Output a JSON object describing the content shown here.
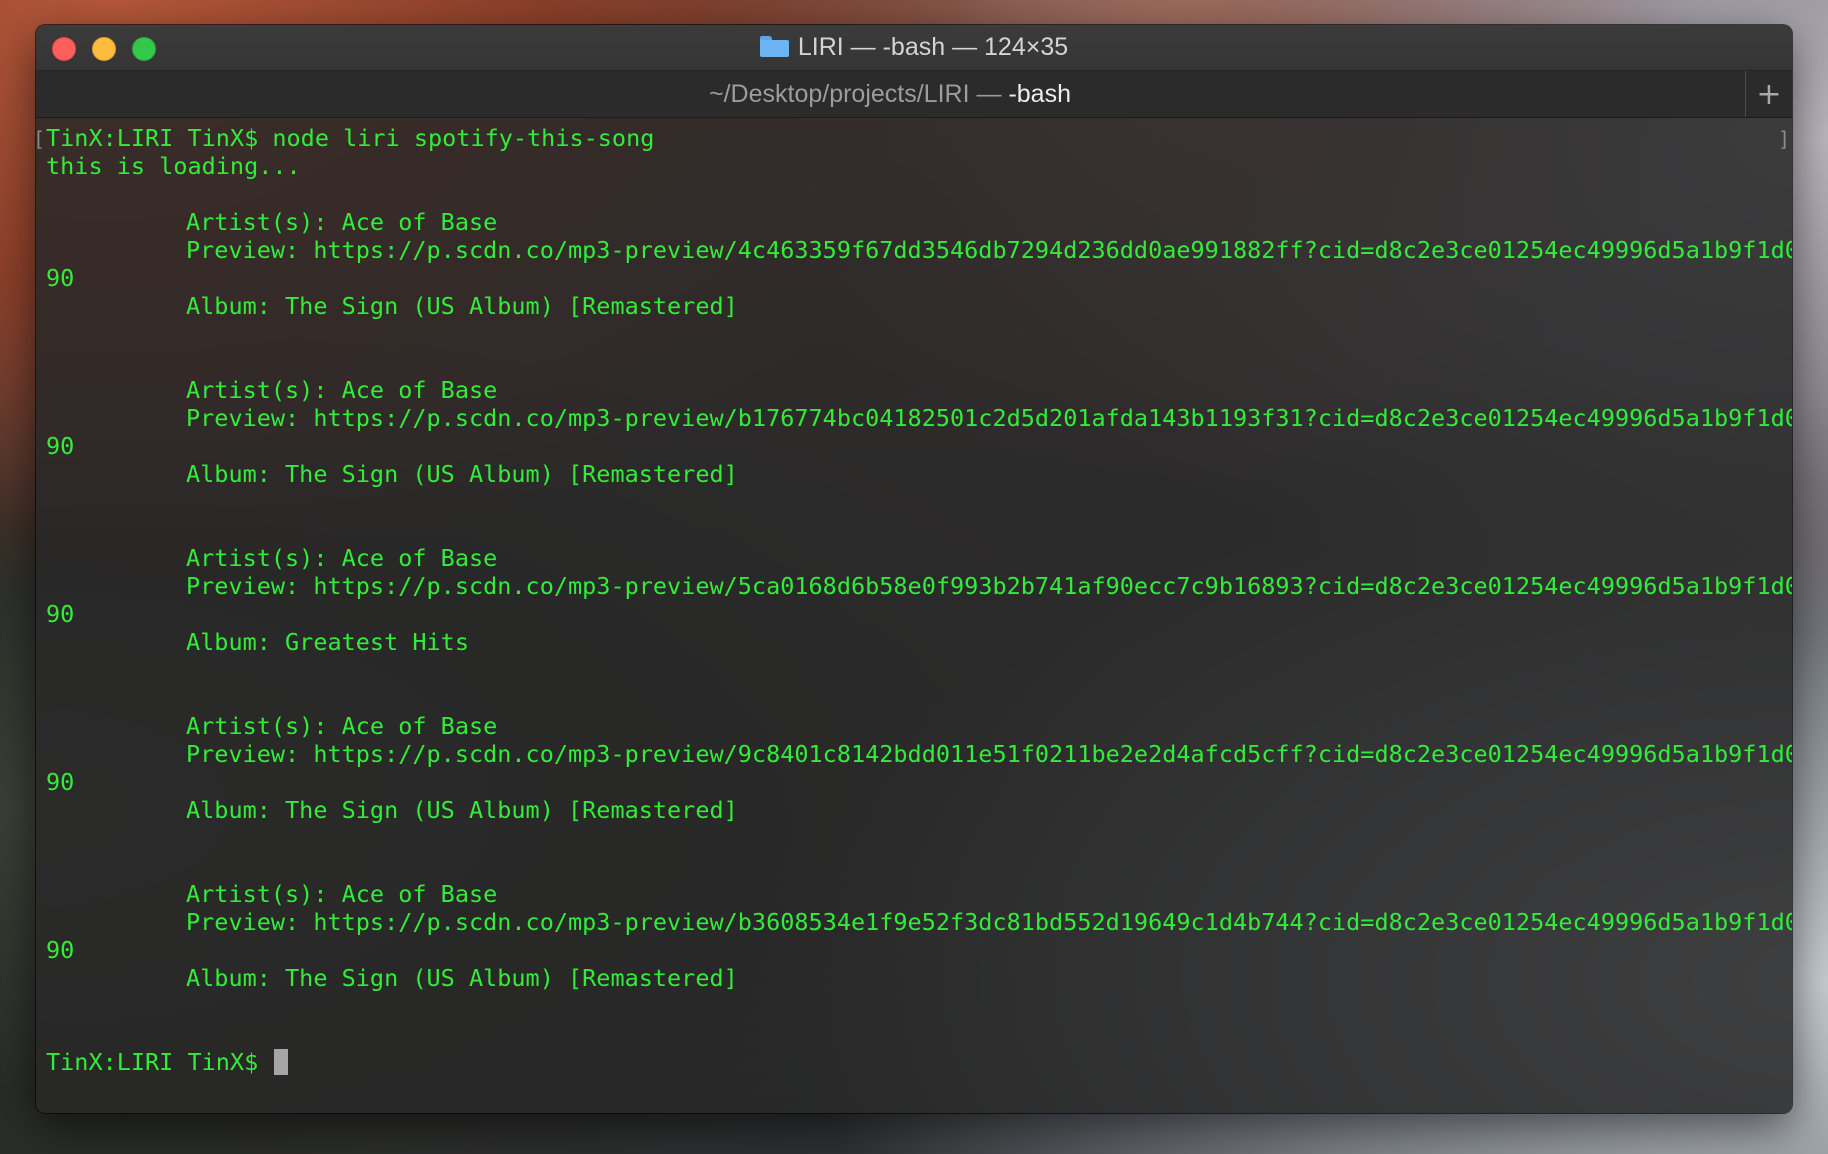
{
  "window": {
    "title": "LIRI — -bash — 124×35",
    "tab_path": "~/Desktop/projects/LIRI — ",
    "tab_command": "-bash",
    "new_tab_label": "+"
  },
  "terminal": {
    "command_line": "TinX:LIRI TinX$ node liri spotify-this-song",
    "loading_message": "this is loading...",
    "tracks": [
      {
        "artist": "Artist(s): Ace of Base",
        "preview": "Preview: https://p.scdn.co/mp3-preview/4c463359f67dd3546db7294d236dd0ae991882ff?cid=d8c2e3ce01254ec49996d5a1b9f1d0",
        "preview_wrap": "90",
        "album": "Album: The Sign (US Album) [Remastered]"
      },
      {
        "artist": "Artist(s): Ace of Base",
        "preview": "Preview: https://p.scdn.co/mp3-preview/b176774bc04182501c2d5d201afda143b1193f31?cid=d8c2e3ce01254ec49996d5a1b9f1d0",
        "preview_wrap": "90",
        "album": "Album: The Sign (US Album) [Remastered]"
      },
      {
        "artist": "Artist(s): Ace of Base",
        "preview": "Preview: https://p.scdn.co/mp3-preview/5ca0168d6b58e0f993b2b741af90ecc7c9b16893?cid=d8c2e3ce01254ec49996d5a1b9f1d0",
        "preview_wrap": "90",
        "album": "Album: Greatest Hits"
      },
      {
        "artist": "Artist(s): Ace of Base",
        "preview": "Preview: https://p.scdn.co/mp3-preview/9c8401c8142bdd011e51f0211be2e2d4afcd5cff?cid=d8c2e3ce01254ec49996d5a1b9f1d0",
        "preview_wrap": "90",
        "album": "Album: The Sign (US Album) [Remastered]"
      },
      {
        "artist": "Artist(s): Ace of Base",
        "preview": "Preview: https://p.scdn.co/mp3-preview/b3608534e1f9e52f3dc81bd552d19649c1d4b744?cid=d8c2e3ce01254ec49996d5a1b9f1d0",
        "preview_wrap": "90",
        "album": "Album: The Sign (US Album) [Remastered]"
      }
    ],
    "prompt": "TinX:LIRI TinX$ "
  },
  "colors": {
    "terminal_text": "#33ec3a",
    "close": "#fc605c",
    "minimize": "#fdbc40",
    "zoom": "#34c84a",
    "folder": "#6cb3f2"
  },
  "icons": {
    "close": "close-icon",
    "minimize": "minimize-icon",
    "zoom": "zoom-icon",
    "folder": "folder-icon",
    "new_tab": "plus-icon",
    "cursor": "block-cursor"
  }
}
